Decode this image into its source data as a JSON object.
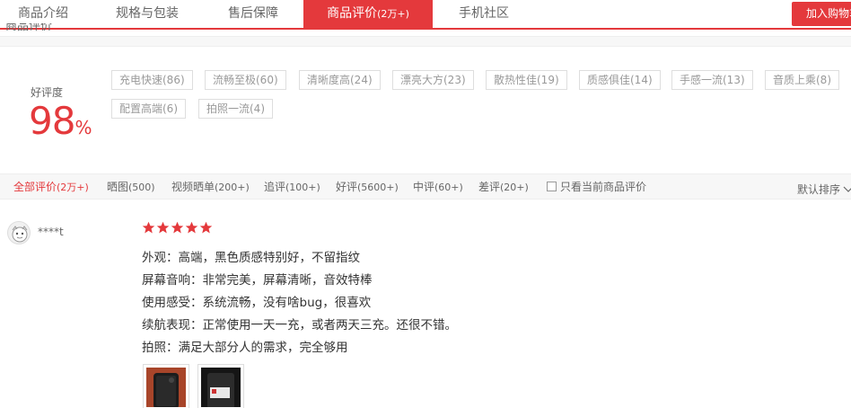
{
  "tabs": [
    {
      "label": "商品介绍",
      "sub": "",
      "active": false
    },
    {
      "label": "规格与包装",
      "sub": "",
      "active": false
    },
    {
      "label": "售后保障",
      "sub": "",
      "active": false
    },
    {
      "label": "商品评价",
      "sub": "(2万+)",
      "active": true
    },
    {
      "label": "手机社区",
      "sub": "",
      "active": false
    }
  ],
  "cart_button": "加入购物车",
  "section_title": "商品评价",
  "rating": {
    "label": "好评度",
    "value": "98",
    "unit": "%"
  },
  "tags": [
    "充电快速(86)",
    "流畅至极(60)",
    "清晰度高(24)",
    "漂亮大方(23)",
    "散热性佳(19)",
    "质感俱佳(14)",
    "手感一流(13)",
    "音质上乘(8)",
    "配置高端(6)",
    "拍照一流(4)"
  ],
  "filters": [
    {
      "label": "全部评价",
      "count": "(2万+)",
      "active": true
    },
    {
      "label": "晒图",
      "count": "(500)",
      "active": false
    },
    {
      "label": "视频晒单",
      "count": "(200+)",
      "active": false
    },
    {
      "label": "追评",
      "count": "(100+)",
      "active": false
    },
    {
      "label": "好评",
      "count": "(5600+)",
      "active": false
    },
    {
      "label": "中评",
      "count": "(60+)",
      "active": false
    },
    {
      "label": "差评",
      "count": "(20+)",
      "active": false
    }
  ],
  "only_current": "只看当前商品评价",
  "sort_label": "默认排序",
  "review": {
    "user": "****t",
    "stars": 5,
    "star_color": "#e4393c",
    "lines": [
      "外观：高端，黑色质感特别好，不留指纹",
      "屏幕音响：非常完美，屏幕清晰，音效特棒",
      "使用感受：系统流畅，没有啥bug，很喜欢",
      "续航表现：正常使用一天一充，或者两天三充。还很不错。",
      "拍照：满足大部分人的需求，完全够用"
    ]
  },
  "colors": {
    "accent": "#e4393c"
  }
}
